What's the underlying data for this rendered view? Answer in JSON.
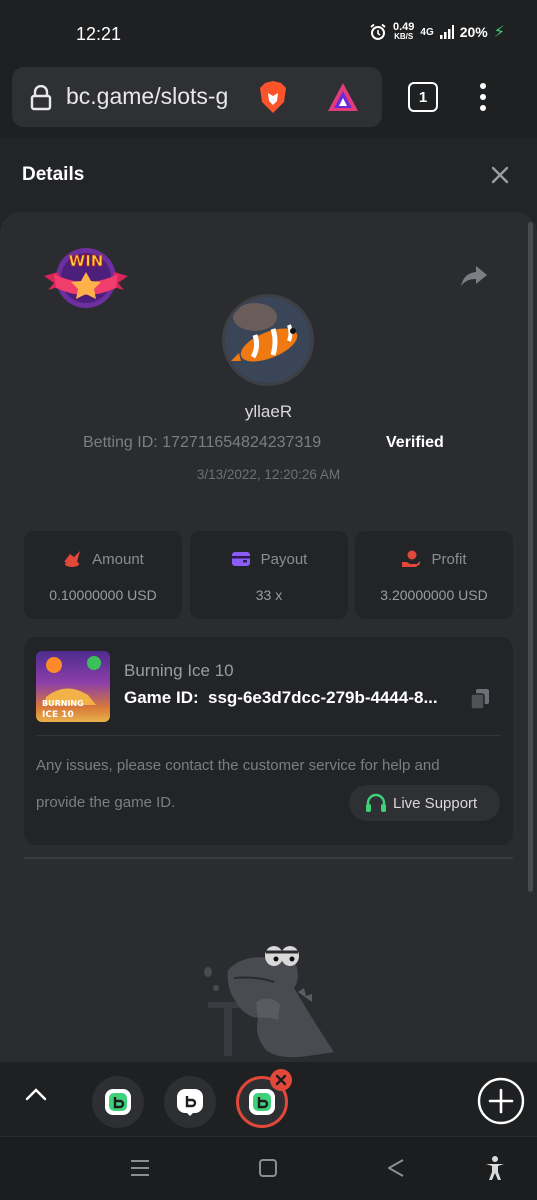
{
  "status_bar": {
    "time": "12:21",
    "speed_value": "0.49",
    "speed_unit": "KB/S",
    "network": "4G",
    "battery": "20%"
  },
  "browser": {
    "url": "bc.game/slots-g",
    "tab_count": "1"
  },
  "details": {
    "title": "Details",
    "username": "yllaeR",
    "betting_id_label": "Betting ID:",
    "betting_id": "172711654824237319",
    "verified": "Verified",
    "timestamp": "3/13/2022, 12:20:26 AM",
    "badge": "WIN"
  },
  "stats": [
    {
      "label": "Amount",
      "value": "0.10000000 USD",
      "icon": "coins-icon",
      "color": "#e2483a"
    },
    {
      "label": "Payout",
      "value": "33 x",
      "icon": "wallet-icon",
      "color": "#8b5cf6"
    },
    {
      "label": "Profit",
      "value": "3.20000000 USD",
      "icon": "hand-coin-icon",
      "color": "#e2483a"
    }
  ],
  "game": {
    "name": "Burning Ice 10",
    "id_label": "Game ID:",
    "id_value": "ssg-6e3d7dcc-279b-4444-8...",
    "thumb_title_line1": "BURNING",
    "thumb_title_line2": "ICE 10"
  },
  "help": {
    "line1": "Any issues, please contact the customer service for help and",
    "line2": "provide the game ID.",
    "support_label": "Live Support"
  },
  "colors": {
    "accent_green": "#3fd07a",
    "accent_red": "#e2483a",
    "accent_purple": "#8b5cf6"
  }
}
